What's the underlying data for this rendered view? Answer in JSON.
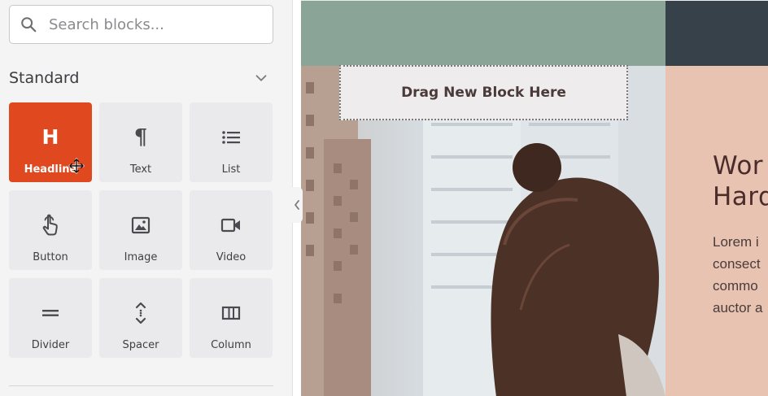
{
  "search": {
    "placeholder": "Search blocks..."
  },
  "section": {
    "title": "Standard"
  },
  "blocks": [
    {
      "label": "Headline",
      "icon": "heading-icon",
      "active": true
    },
    {
      "label": "Text",
      "icon": "paragraph-icon"
    },
    {
      "label": "List",
      "icon": "list-icon"
    },
    {
      "label": "Button",
      "icon": "pointer-hand-icon"
    },
    {
      "label": "Image",
      "icon": "image-icon"
    },
    {
      "label": "Video",
      "icon": "video-camera-icon"
    },
    {
      "label": "Divider",
      "icon": "divider-icon"
    },
    {
      "label": "Spacer",
      "icon": "spacer-icon"
    },
    {
      "label": "Column",
      "icon": "column-icon"
    }
  ],
  "glyphs": {
    "heading": "H",
    "paragraph": "¶"
  },
  "canvas": {
    "dropzone_label": "Drag New Block Here",
    "heading": "Wor\nHard",
    "body": "Lorem i\nconsect\ncommo\nauctor a"
  },
  "colors": {
    "accent": "#e0491f",
    "sage": "#8aa497",
    "peach": "#e8c3b1",
    "dark": "#36414a"
  }
}
